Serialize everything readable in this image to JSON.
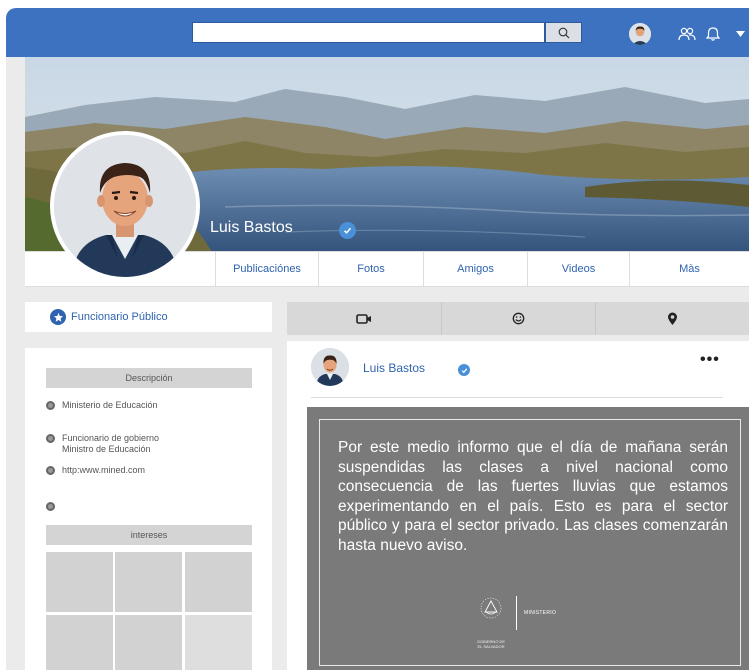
{
  "topbar": {
    "search_placeholder": "",
    "icons": [
      "search-icon",
      "avatar",
      "friends-icon",
      "bell-icon",
      "caret-down-icon"
    ]
  },
  "profile": {
    "name": "Luis Bastos",
    "verified": true
  },
  "tabs": [
    {
      "label": "Publicaciónes"
    },
    {
      "label": "Fotos"
    },
    {
      "label": "Amigos"
    },
    {
      "label": "Videos"
    },
    {
      "label": "Màs"
    }
  ],
  "role": {
    "label": "Funcionario Público"
  },
  "about": {
    "description_header": "Descripción",
    "items": [
      {
        "text": "Ministerio de Educación"
      },
      {
        "line1": "Funcionario de gobierno",
        "line2": "Ministro de Educación"
      },
      {
        "text": "http:www.mined.com"
      },
      {
        "text": ""
      }
    ],
    "interests_header": "intereses"
  },
  "post_tools": {
    "icons": [
      "video-camera-icon",
      "smiley-icon",
      "location-pin-icon"
    ]
  },
  "post": {
    "author": "Luis Bastos",
    "menu": "•••",
    "text": "Por este medio informo que el día de mañana serán suspendidas las clases a nivel nacional como consecuencia de las fuertes lluvias que estamos experimentando en el país. Esto es para el sector público y para el sector privado. Las clases comenzarán hasta nuevo aviso.",
    "logo_label": "MINISTERIO",
    "gov_line1": "GOBIERNO DE",
    "gov_line2": "EL SALVADOR"
  },
  "colors": {
    "topbar": "#3c72bf",
    "link": "#2f63b0",
    "verified": "#4a90d9",
    "post_image_bg": "#7a7a7a"
  }
}
